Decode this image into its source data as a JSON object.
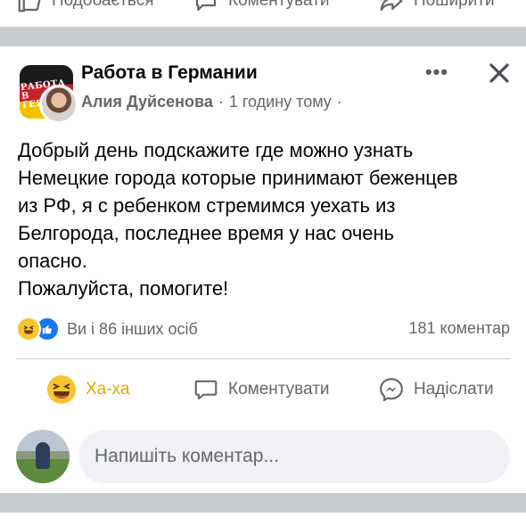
{
  "top_actions": {
    "like_label": "Подобається",
    "comment_label": "Коментувати",
    "share_label": "Поширити"
  },
  "post": {
    "group_name": "Работа в Германии",
    "group_logo_text": "РАБОТА В ГЕРМ",
    "author": "Алия Дуйсенова",
    "time": "1 годину тому",
    "separator": "·",
    "text_lines": [
      "Добрый день подскажите где можно узнать",
      "Немецкие города которые принимают беженцев",
      "из РФ, я с ребенком стремимся уехать из",
      "Белгорода, последнее время у нас очень",
      "опасно.",
      "Пожалуйста, помогите!"
    ],
    "reactions_text": "Ви і 86 інших осіб",
    "reaction_icons": [
      "haha-icon",
      "like-icon"
    ],
    "comment_count": "181 коментар"
  },
  "actions": {
    "haha_label": "Ха-ха",
    "comment_label": "Коментувати",
    "send_label": "Надіслати"
  },
  "composer": {
    "placeholder": "Напишіть коментар..."
  },
  "colors": {
    "separator": "#c9ccd1",
    "secondary_text": "#65676b",
    "haha_active": "#e6a800",
    "like_blue": "#1877f2",
    "input_bg": "#f0f2f5"
  }
}
